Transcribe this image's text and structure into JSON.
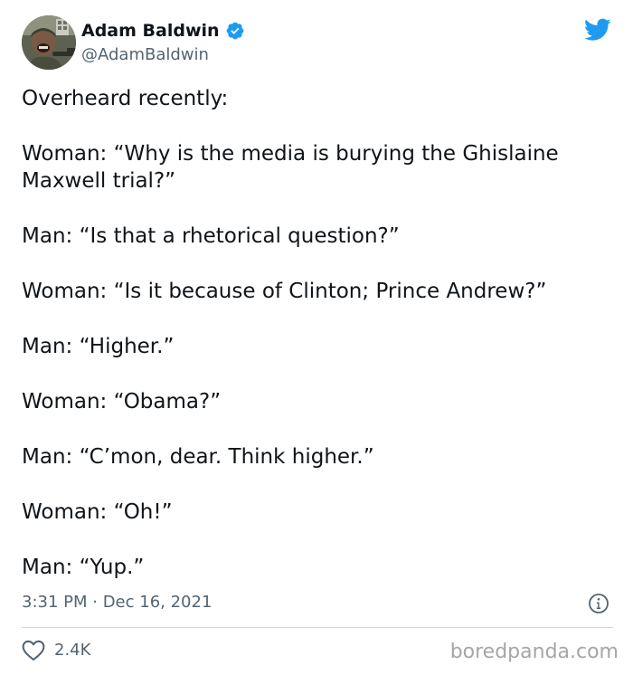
{
  "author": {
    "display_name": "Adam Baldwin",
    "handle": "@AdamBaldwin",
    "verified_icon": "verified-badge-icon"
  },
  "tweet": {
    "paragraphs": [
      "Overheard recently:",
      "Woman: “Why is the media is burying the Ghislaine Maxwell trial?”",
      "Man: “Is that a rhetorical question?”",
      "Woman: “Is it because of Clinton; Prince Andrew?”",
      "Man: “Higher.”",
      "Woman: “Obama?”",
      "Man: “C’mon, dear. Think higher.”",
      "Woman: “Oh!”",
      "Man: “Yup.”"
    ],
    "timestamp": "3:31 PM · Dec 16, 2021",
    "like_count": "2.4K"
  },
  "watermark": "boredpanda.com",
  "colors": {
    "twitter_blue": "#1d9bf0",
    "text": "#0f1419",
    "secondary_text": "#536471",
    "divider": "#cfd9de"
  }
}
